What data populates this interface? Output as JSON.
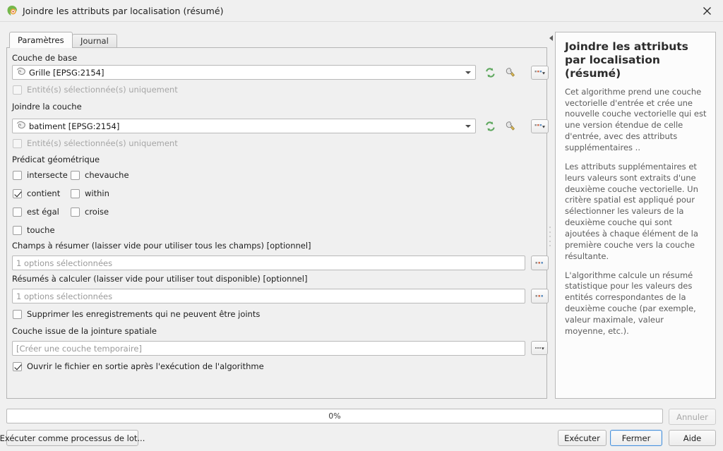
{
  "window": {
    "title": "Joindre les attributs par localisation (résumé)",
    "app_icon": "qgis-logo-icon",
    "close_icon": "close-icon"
  },
  "tabs": [
    {
      "label": "Paramètres",
      "active": true
    },
    {
      "label": "Journal",
      "active": false
    }
  ],
  "parameters": {
    "base_layer": {
      "label": "Couche de base",
      "value": "Grille [EPSG:2154]",
      "icon": "polygon-layer-icon",
      "selected_only": {
        "label": "Entité(s) sélectionnée(s) uniquement",
        "checked": false,
        "disabled": true
      }
    },
    "join_layer": {
      "label": "Joindre la couche",
      "value": "batiment [EPSG:2154]",
      "icon": "polygon-layer-icon",
      "selected_only": {
        "label": "Entité(s) sélectionnée(s) uniquement",
        "checked": false,
        "disabled": true
      }
    },
    "geometric_predicate": {
      "label": "Prédicat géométrique",
      "options": [
        {
          "label": "intersecte",
          "checked": false
        },
        {
          "label": "chevauche",
          "checked": false
        },
        {
          "label": "contient",
          "checked": true
        },
        {
          "label": "within",
          "checked": false
        },
        {
          "label": "est égal",
          "checked": false
        },
        {
          "label": "croise",
          "checked": false
        },
        {
          "label": "touche",
          "checked": false
        }
      ]
    },
    "fields_to_summarise": {
      "label": "Champs à résumer (laisser vide pour utiliser tous les champs) [optionnel]",
      "value": "1 options sélectionnées",
      "button": "browse-button"
    },
    "summaries_to_calculate": {
      "label": "Résumés à calculer (laisser vide pour utiliser tout disponible) [optionnel]",
      "value": "1 options sélectionnées",
      "button": "browse-button"
    },
    "discard_records": {
      "label": "Supprimer les enregistrements qui ne peuvent être joints",
      "checked": false
    },
    "output_layer": {
      "label": "Couche issue de la jointure spatiale",
      "value": "[Créer une couche temporaire]",
      "button": "browse-button"
    },
    "open_output": {
      "label": "Ouvrir le fichier en sortie après l'exécution de l'algorithme",
      "checked": true
    }
  },
  "layer_tools": {
    "refresh_icon": "refresh-icon",
    "expression_icon": "wrench-icon",
    "browse_icon": "browse-icon"
  },
  "help": {
    "title": "Joindre les attributs par localisation (résumé)",
    "paragraphs": [
      "Cet algorithme prend une couche vectorielle d'entrée et crée une nouvelle couche vectorielle qui est une version étendue de celle d'entrée, avec des attributs supplémentaires ..",
      "Les attributs supplémentaires et leurs valeurs sont extraits d'une deuxième couche vectorielle. Un critère spatial est appliqué pour sélectionner les valeurs de la deuxième couche qui sont ajoutées à chaque élément de la première couche vers la couche résultante.",
      "L'algorithme calcule un résumé statistique pour les valeurs des entités correspondantes de la deuxième couche (par exemple, valeur maximale, valeur moyenne, etc.)."
    ],
    "collapse_icon": "collapse-left-icon"
  },
  "footer": {
    "progress_text": "0%",
    "progress_value": 0,
    "cancel_label": "Annuler",
    "cancel_disabled": true,
    "batch_label": "Exécuter comme processus de lot...",
    "run_label": "Exécuter",
    "close_label": "Fermer",
    "help_label": "Aide"
  },
  "colors": {
    "accent": "#4a90d9",
    "refresh_green": "#5fa85f",
    "window_bg": "#f0f0f0",
    "panel_bg": "#fcfcfc"
  }
}
